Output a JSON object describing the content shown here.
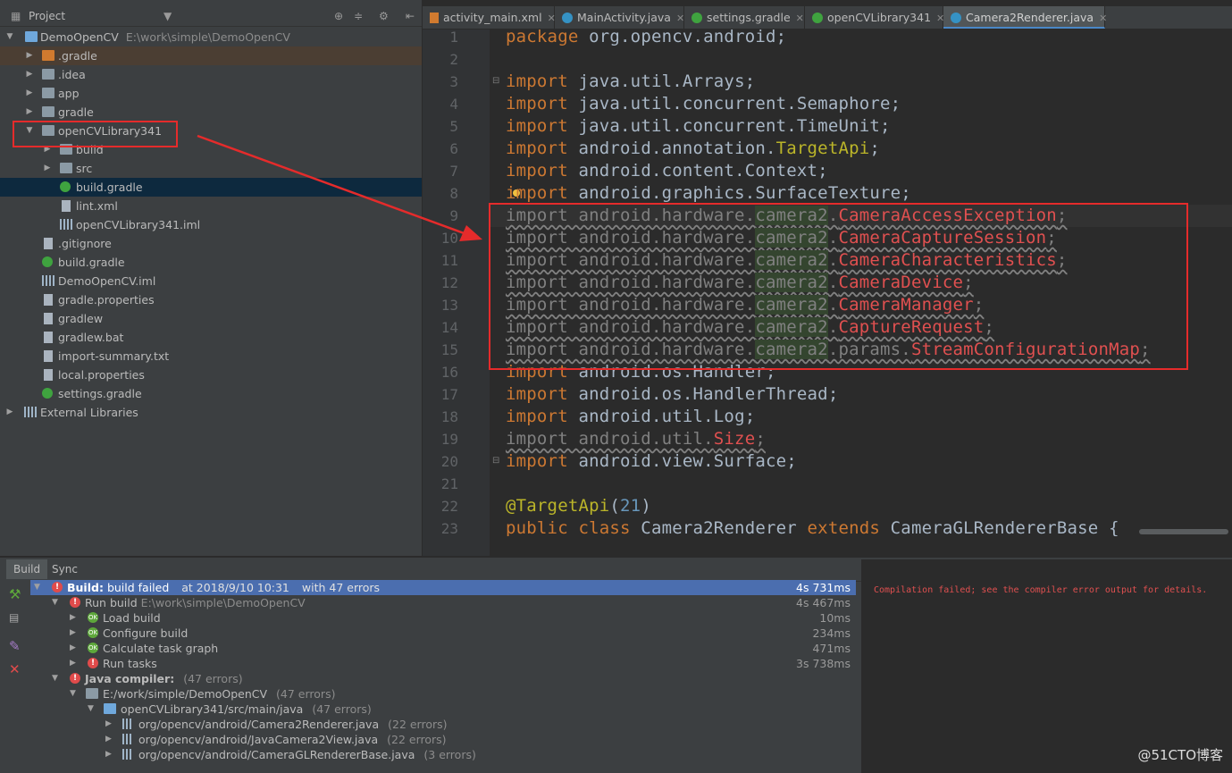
{
  "project": {
    "title": "Project",
    "tree": [
      {
        "label": "DemoOpenCV",
        "path": "E:\\work\\simple\\DemoOpenCV",
        "icon": "module-icon"
      },
      {
        "label": ".gradle",
        "icon": "folder-icon"
      },
      {
        "label": ".idea",
        "icon": "folder-icon"
      },
      {
        "label": "app",
        "icon": "folder-icon"
      },
      {
        "label": "gradle",
        "icon": "folder-icon"
      },
      {
        "label": "openCVLibrary341",
        "icon": "module-icon"
      },
      {
        "label": "build",
        "icon": "folder-icon"
      },
      {
        "label": "src",
        "icon": "folder-icon"
      },
      {
        "label": "build.gradle",
        "icon": "gradle-icon"
      },
      {
        "label": "lint.xml",
        "icon": "file-icon"
      },
      {
        "label": "openCVLibrary341.iml",
        "icon": "file-icon"
      },
      {
        "label": ".gitignore",
        "icon": "file-icon"
      },
      {
        "label": "build.gradle",
        "icon": "gradle-icon"
      },
      {
        "label": "DemoOpenCV.iml",
        "icon": "file-icon"
      },
      {
        "label": "gradle.properties",
        "icon": "file-icon"
      },
      {
        "label": "gradlew",
        "icon": "file-icon"
      },
      {
        "label": "gradlew.bat",
        "icon": "file-icon"
      },
      {
        "label": "import-summary.txt",
        "icon": "file-icon"
      },
      {
        "label": "local.properties",
        "icon": "file-icon"
      },
      {
        "label": "settings.gradle",
        "icon": "gradle-icon"
      },
      {
        "label": "External Libraries",
        "icon": "library-icon"
      }
    ]
  },
  "tabs": [
    {
      "label": "activity_main.xml"
    },
    {
      "label": "MainActivity.java"
    },
    {
      "label": "settings.gradle"
    },
    {
      "label": "openCVLibrary341"
    },
    {
      "label": "Camera2Renderer.java"
    }
  ],
  "editor": {
    "line_numbers": [
      "1",
      "2",
      "3",
      "4",
      "5",
      "6",
      "7",
      "8",
      "9",
      "10",
      "11",
      "12",
      "13",
      "14",
      "15",
      "16",
      "17",
      "18",
      "19",
      "20",
      "21",
      "22",
      "23"
    ],
    "lines": {
      "l1": {
        "kw": "package",
        "rest": " org.opencv.android;"
      },
      "l3": {
        "kw": "import",
        "rest": " java.util.Arrays;"
      },
      "l4": {
        "kw": "import",
        "rest": " java.util.concurrent.Semaphore;"
      },
      "l5": {
        "kw": "import",
        "rest": " java.util.concurrent.TimeUnit;"
      },
      "l6": {
        "kw": "import",
        "pre": " android.annotation.",
        "cls": "TargetApi",
        "end": ";"
      },
      "l7": {
        "kw": "import",
        "rest": " android.content.Context;"
      },
      "l8": {
        "kw": "import",
        "rest": " android.graphics.SurfaceTexture;"
      },
      "l9": {
        "pre": "import android.hardware.",
        "pkg": "camera2",
        "dot": ".",
        "cls": "CameraAccessException",
        "end": ";"
      },
      "l10": {
        "pre": "import android.hardware.",
        "pkg": "camera2",
        "dot": ".",
        "cls": "CameraCaptureSession",
        "end": ";"
      },
      "l11": {
        "pre": "import android.hardware.",
        "pkg": "camera2",
        "dot": ".",
        "cls": "CameraCharacteristics",
        "end": ";"
      },
      "l12": {
        "pre": "import android.hardware.",
        "pkg": "camera2",
        "dot": ".",
        "cls": "CameraDevice",
        "end": ";"
      },
      "l13": {
        "pre": "import android.hardware.",
        "pkg": "camera2",
        "dot": ".",
        "cls": "CameraManager",
        "end": ";"
      },
      "l14": {
        "pre": "import android.hardware.",
        "pkg": "camera2",
        "dot": ".",
        "cls": "CaptureRequest",
        "end": ";"
      },
      "l15": {
        "pre": "import android.hardware.",
        "pkg": "camera2",
        "dot": ".params.",
        "cls": "StreamConfigurationMap",
        "end": ";"
      },
      "l16": {
        "kw": "import",
        "rest": " android.os.Handler;"
      },
      "l17": {
        "kw": "import",
        "rest": " android.os.HandlerThread;"
      },
      "l18": {
        "kw": "import",
        "rest": " android.util.Log;"
      },
      "l19": {
        "pre": "import android.util.",
        "cls": "Size",
        "end": ";"
      },
      "l20": {
        "kw": "import",
        "rest": " android.view.Surface;"
      },
      "l22": {
        "ann": "@TargetApi",
        "open": "(",
        "num": "21",
        "close": ")"
      },
      "l23": {
        "kw1": "public class",
        "name": " Camera2Renderer ",
        "kw2": "extends",
        "rest": " CameraGLRendererBase {"
      }
    }
  },
  "build": {
    "tabs": [
      "Build",
      "Sync"
    ],
    "rows": [
      {
        "label": "Build:",
        "status": "build failed",
        "meta": "at 2018/9/10 10:31",
        "meta2": "with 47 errors",
        "duration": "4s 731ms"
      },
      {
        "label": "Run build",
        "meta": "E:\\work\\simple\\DemoOpenCV",
        "duration": "4s 467ms"
      },
      {
        "label": "Load build",
        "duration": "10ms"
      },
      {
        "label": "Configure build",
        "duration": "234ms"
      },
      {
        "label": "Calculate task graph",
        "duration": "471ms"
      },
      {
        "label": "Run tasks",
        "duration": "3s 738ms"
      },
      {
        "label": "Java compiler:",
        "meta": "(47 errors)"
      },
      {
        "label": "E:/work/simple/DemoOpenCV",
        "meta": "(47 errors)"
      },
      {
        "label": "openCVLibrary341/src/main/java",
        "meta": "(47 errors)"
      },
      {
        "label": "org/opencv/android/Camera2Renderer.java",
        "meta": "(22 errors)"
      },
      {
        "label": "org/opencv/android/JavaCamera2View.java",
        "meta": "(22 errors)"
      },
      {
        "label": "org/opencv/android/CameraGLRendererBase.java",
        "meta": "(3 errors)"
      }
    ],
    "output": "Compilation failed; see the compiler error output for details."
  },
  "watermark": "@51CTO博客",
  "colors": {
    "keyword": "#cc7832",
    "error": "#e05050",
    "annotation_box": "#e52b2b",
    "selection": "#4b6eaf"
  }
}
